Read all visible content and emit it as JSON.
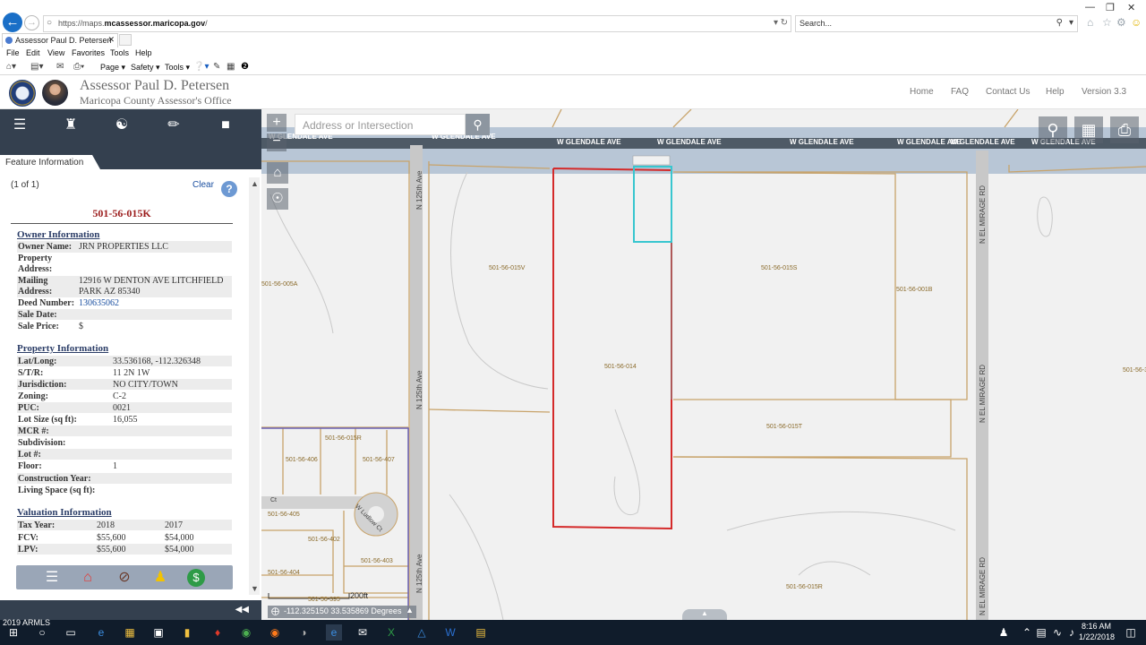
{
  "browser": {
    "url_prefix": "https://maps.",
    "url_domain": "mcassessor.maricopa.gov",
    "url_suffix": "/",
    "search_placeholder": "Search...",
    "tab_title": "Assessor Paul D. Petersen",
    "menu": [
      "File",
      "Edit",
      "View",
      "Favorites",
      "Tools",
      "Help"
    ],
    "commands": {
      "page": "Page",
      "safety": "Safety",
      "tools": "Tools"
    }
  },
  "header": {
    "title": "Assessor Paul D. Petersen",
    "subtitle": "Maricopa County Assessor's Office",
    "nav": [
      "Home",
      "FAQ",
      "Contact Us",
      "Help",
      "Version 3.3"
    ]
  },
  "panel": {
    "tab_label": "Feature Information",
    "count": "(1 of 1)",
    "clear_label": "Clear",
    "help_label": "?",
    "apn": "501-56-015K",
    "owner": {
      "heading": "Owner Information",
      "rows": [
        {
          "label": "Owner Name:",
          "value": "JRN PROPERTIES LLC"
        },
        {
          "label": "Property",
          "value": ""
        },
        {
          "label": "Address:",
          "value": ""
        },
        {
          "label": "Mailing",
          "value": "12916 W DENTON AVE LITCHFIELD"
        },
        {
          "label": "Address:",
          "value": "PARK AZ 85340"
        },
        {
          "label": "Deed Number:",
          "value": "130635062"
        },
        {
          "label": "Sale Date:",
          "value": ""
        },
        {
          "label": "Sale Price:",
          "value": "$"
        }
      ]
    },
    "property": {
      "heading": "Property Information",
      "rows": [
        {
          "label": "Lat/Long:",
          "value": "33.536168, -112.326348"
        },
        {
          "label": "S/T/R:",
          "value": "11 2N 1W"
        },
        {
          "label": "Jurisdiction:",
          "value": "NO CITY/TOWN"
        },
        {
          "label": "Zoning:",
          "value": "C-2"
        },
        {
          "label": "PUC:",
          "value": "0021"
        },
        {
          "label": "Lot Size (sq ft):",
          "value": "16,055"
        },
        {
          "label": "MCR #:",
          "value": ""
        },
        {
          "label": "Subdivision:",
          "value": ""
        },
        {
          "label": "Lot #:",
          "value": ""
        },
        {
          "label": "Floor:",
          "value": "1"
        },
        {
          "label": "Construction Year:",
          "value": ""
        },
        {
          "label": "Living Space (sq ft):",
          "value": ""
        }
      ]
    },
    "valuation": {
      "heading": "Valuation Information",
      "rows": [
        {
          "label": "Tax Year:",
          "v1": "2018",
          "v2": "2017"
        },
        {
          "label": "FCV:",
          "v1": "$55,600",
          "v2": "$54,000"
        },
        {
          "label": "LPV:",
          "v1": "$55,600",
          "v2": "$54,000"
        }
      ]
    }
  },
  "map": {
    "search_placeholder": "Address or Intersection",
    "coordinates": "-112.325150 33.535869 Degrees",
    "scale": "200ft",
    "streets": {
      "glendale": "W GLENDALE AVE",
      "n125": "N 125th Ave",
      "mirage": "N EL MIRAGE RD",
      "ct": "W Ludlow Ct",
      "ct_short": "Ct"
    },
    "parcels": [
      "501-56-015V",
      "501-56-014",
      "501-56-015S",
      "501-56-001B",
      "501-56-005A",
      "501-56-015T",
      "501-56-015R",
      "501-56-406",
      "501-56-407",
      "501-56-405",
      "501-56-402",
      "501-56-403",
      "501-56-404",
      "501-56-395",
      "501-56-394",
      "501-55-0"
    ],
    "selected_parcel_color": "#d42a2a",
    "highlight_color": "#38c6cf",
    "parcel_line_color": "#c8a36a"
  },
  "taskbar": {
    "tag": "2019 ARMLS",
    "time": "8:16 AM",
    "date": "1/22/2018"
  }
}
